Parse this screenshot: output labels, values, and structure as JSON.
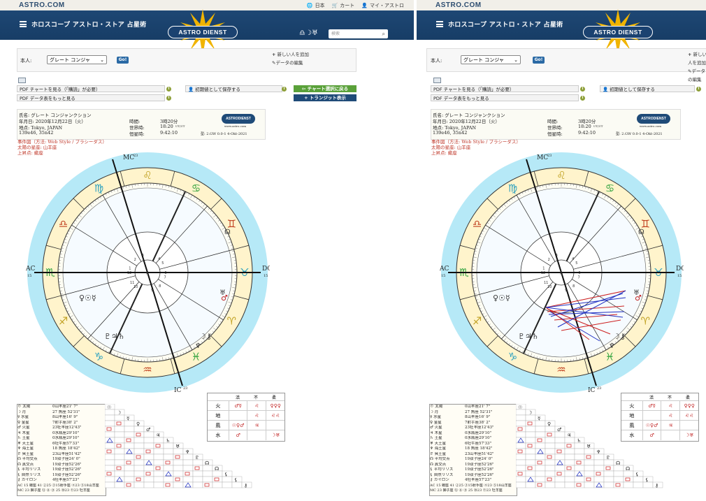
{
  "site": {
    "brand": "ASTRO.COM",
    "logo": "ASTRO DIENST",
    "mini_logo": "ASTRODIENST",
    "mini_logo_sub": "www.astro.com"
  },
  "toplinks": {
    "lang": "日本",
    "cart": "カート",
    "account": "マイ・アストロ"
  },
  "nav": {
    "title": "ホロスコープ アストロ・ストア 占星術",
    "search_placeholder": "検索",
    "signs": "♎☽♅"
  },
  "form": {
    "person_label": "本人:",
    "person_value": "グレート コンジャ",
    "go_label": "Go!",
    "add_person": "新しい人を追加",
    "edit_data": "データの編集"
  },
  "links": {
    "pdf_chart": "PDF チャートを見る（「購読」が必要）",
    "pdf_data": "PDF データ表をもっと見る",
    "save_default": "初期値として保存する",
    "back_to_chart": "チャート選択に戻る",
    "transit": "トランジット表示"
  },
  "chart_info": {
    "name": "氏名: グレート コンジャンクション",
    "date": "年月日: 2020年12月22日（火）",
    "place": "地点: Tokyo, JAPAN",
    "coords": "139e46, 35n42",
    "time_label": "時間:",
    "time_value": "3時20分",
    "ut_label": "世界時:",
    "ut_value": "18:20",
    "ut_unit": "UT/UT",
    "st_label": "恒星時:",
    "st_value": "9:42:10",
    "type": "型: 2.GW  0.0-1  4-Okt-2021",
    "event": "事件図（方法: Web Style / プラシーダス）",
    "sun_sign": "太陽の星座: 山羊座",
    "asc": "上昇点: 蠍座"
  },
  "wheel": {
    "mc": "MC",
    "mc_deg": "23",
    "ic": "IC",
    "ic_deg": "23",
    "ac": "AC",
    "ac_deg": "15",
    "dc": "DC",
    "dc_deg": "15",
    "signs": [
      "♏",
      "♎",
      "♍",
      "♌",
      "♋",
      "♊",
      "♉",
      "♈",
      "♓",
      "♒",
      "♑",
      "♐"
    ],
    "houses": [
      "1",
      "2",
      "3",
      "4",
      "5",
      "6",
      "7",
      "8",
      "9",
      "10",
      "11",
      "12"
    ],
    "planet_glyphs_bottom": "♇♃♄",
    "planet_glyphs_left": "♀☉☿",
    "planet_glyphs_right": "♂",
    "planet_glyphs_lowright": "☽⚷",
    "planet_glyphs_neptune": "♆",
    "planet_glyphs_top_right": "☊",
    "planet_glyphs_right2": "♅"
  },
  "planets": [
    {
      "name": "☉ 太陽",
      "pos": "0山羊座21' 7\""
    },
    {
      "name": "☽ 月",
      "pos": "27 魚座 52'31\""
    },
    {
      "name": "☿ 水星",
      "pos": "8山羊座16' 9\""
    },
    {
      "name": "♀ 金星",
      "pos": "7射手座38' 2\""
    },
    {
      "name": "♂ 火星",
      "pos": "23牡羊座12'43\""
    },
    {
      "name": "♃ 木星",
      "pos": "0水瓶座29'10\""
    },
    {
      "name": "♄ 土星",
      "pos": "0水瓶座29'10\""
    },
    {
      "name": "♅ 天王星",
      "pos": "6牡牛座57'33\""
    },
    {
      "name": "♆ 海王星",
      "pos": "18 魚座 18'42\""
    },
    {
      "name": "♇ 冥王星",
      "pos": "23山羊座51'42\""
    },
    {
      "name": "☊ 平均交点",
      "pos": "19双子座24' 0\""
    },
    {
      "name": "☊ 真交点",
      "pos": "19双子座52'26\""
    },
    {
      "name": "⚸ 平均リリス",
      "pos": "19双子座52'26\""
    },
    {
      "name": "⚸ 自然リリス",
      "pos": "19双子座52'26\""
    },
    {
      "name": "⚷ カイロン",
      "pos": "4牡羊座57'23\""
    }
  ],
  "house_rows": {
    "ac_row": "AC 15 蠍座 41 ②25 ③15射手座 ④23 ⑤18山羊座",
    "mc_row": "MC 23 獅子座 ⑫ ⑧ ⑨ 25 ⑩23 ⑪23 牡羊座"
  },
  "elements": {
    "headers": [
      "活",
      "不",
      "柔"
    ],
    "rows": [
      {
        "label": "火",
        "cells": [
          "♂☿",
          "♌",
          "♀♀♀"
        ]
      },
      {
        "label": "地",
        "cells": [
          "",
          "♌",
          "♌♌"
        ]
      },
      {
        "label": "風",
        "cells": [
          "☉♀♂",
          "♃",
          ""
        ]
      },
      {
        "label": "水",
        "cells": [
          "♂",
          "",
          "☽♅"
        ]
      }
    ]
  },
  "colors": {
    "nav": "#1b4270",
    "sky": "#b6e9f7",
    "sign_ring": "#fff4cc",
    "red": "#cc2020",
    "blue": "#2030c0",
    "green": "#2aa03a"
  }
}
